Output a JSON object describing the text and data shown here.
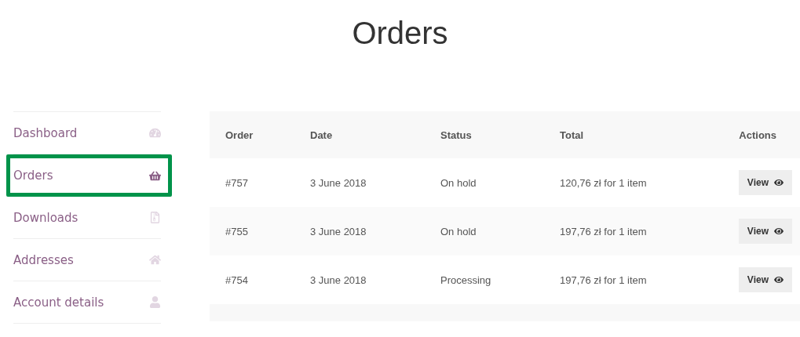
{
  "page_title": "Orders",
  "sidebar": {
    "items": [
      {
        "label": "Dashboard",
        "selected": false
      },
      {
        "label": "Orders",
        "selected": true
      },
      {
        "label": "Downloads",
        "selected": false
      },
      {
        "label": "Addresses",
        "selected": false
      },
      {
        "label": "Account details",
        "selected": false
      }
    ]
  },
  "table": {
    "columns": [
      "Order",
      "Date",
      "Status",
      "Total",
      "Actions"
    ],
    "rows": [
      {
        "order": "#757",
        "date": "3 June 2018",
        "status": "On hold",
        "total": "120,76 zł for 1 item",
        "action": "View"
      },
      {
        "order": "#755",
        "date": "3 June 2018",
        "status": "On hold",
        "total": "197,76 zł for 1 item",
        "action": "View"
      },
      {
        "order": "#754",
        "date": "3 June 2018",
        "status": "Processing",
        "total": "197,76 zł for 1 item",
        "action": "View"
      }
    ]
  }
}
